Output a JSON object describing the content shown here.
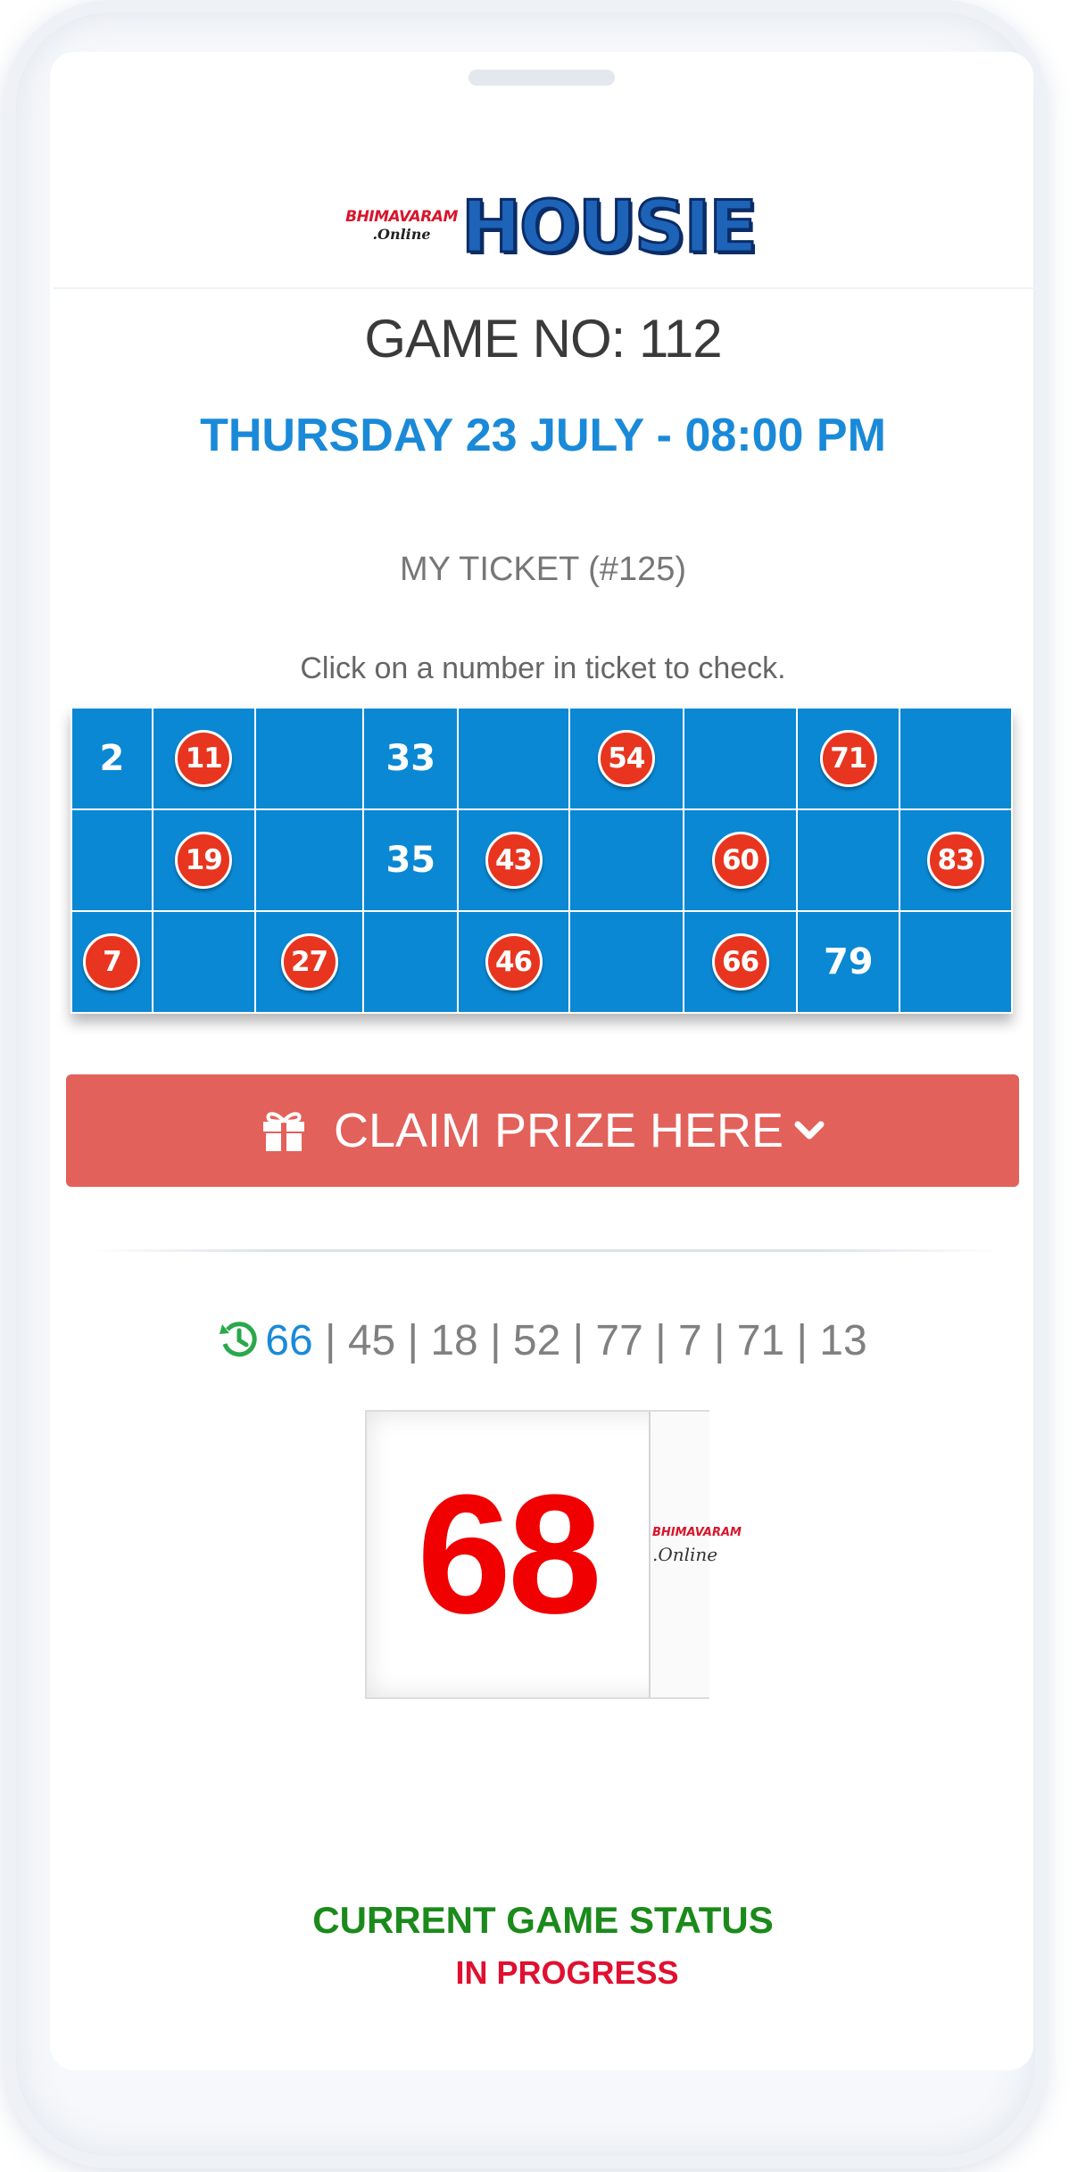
{
  "logo": {
    "brand_top": "BHIMAVARAM",
    "brand_bottom": ".Online",
    "title": "HOUSIE"
  },
  "game": {
    "number_label": "GAME NO: 112",
    "datetime": "THURSDAY 23 JULY - 08:00 PM"
  },
  "ticket": {
    "title": "MY TICKET (#125)",
    "hint": "Click on a number in ticket to check.",
    "rows": [
      [
        {
          "n": "2",
          "marked": false
        },
        {
          "n": "11",
          "marked": true
        },
        {
          "n": "",
          "marked": false
        },
        {
          "n": "33",
          "marked": false
        },
        {
          "n": "",
          "marked": false
        },
        {
          "n": "54",
          "marked": true
        },
        {
          "n": "",
          "marked": false
        },
        {
          "n": "71",
          "marked": true
        },
        {
          "n": "",
          "marked": false
        }
      ],
      [
        {
          "n": "",
          "marked": false
        },
        {
          "n": "19",
          "marked": true
        },
        {
          "n": "",
          "marked": false
        },
        {
          "n": "35",
          "marked": false
        },
        {
          "n": "43",
          "marked": true
        },
        {
          "n": "",
          "marked": false
        },
        {
          "n": "60",
          "marked": true
        },
        {
          "n": "",
          "marked": false
        },
        {
          "n": "83",
          "marked": true
        }
      ],
      [
        {
          "n": "7",
          "marked": true
        },
        {
          "n": "",
          "marked": false
        },
        {
          "n": "27",
          "marked": true
        },
        {
          "n": "",
          "marked": false
        },
        {
          "n": "46",
          "marked": true
        },
        {
          "n": "",
          "marked": false
        },
        {
          "n": "66",
          "marked": true
        },
        {
          "n": "79",
          "marked": false
        },
        {
          "n": "",
          "marked": false
        }
      ]
    ]
  },
  "claim": {
    "label": "CLAIM PRIZE HERE",
    "icon": "gift-icon",
    "chevron": "chevron-down-icon"
  },
  "history": {
    "icon": "history-icon",
    "latest": "66",
    "rest": " | 45 | 18 | 52 | 77 | 7 | 71 | 13"
  },
  "current_ball": {
    "number": "68",
    "side_brand_top": "BHIMAVARAM",
    "side_brand_bottom": ".Online"
  },
  "status": {
    "title": "CURRENT GAME STATUS",
    "value": "IN PROGRESS"
  },
  "colors": {
    "ticket_bg": "#0a88d4",
    "marked_circle": "#e8351f",
    "claim_button": "#e2615a",
    "accent_blue": "#1a8ad8",
    "status_green": "#1b8a1b",
    "status_red": "#e01030",
    "ball_red": "#f00000"
  }
}
